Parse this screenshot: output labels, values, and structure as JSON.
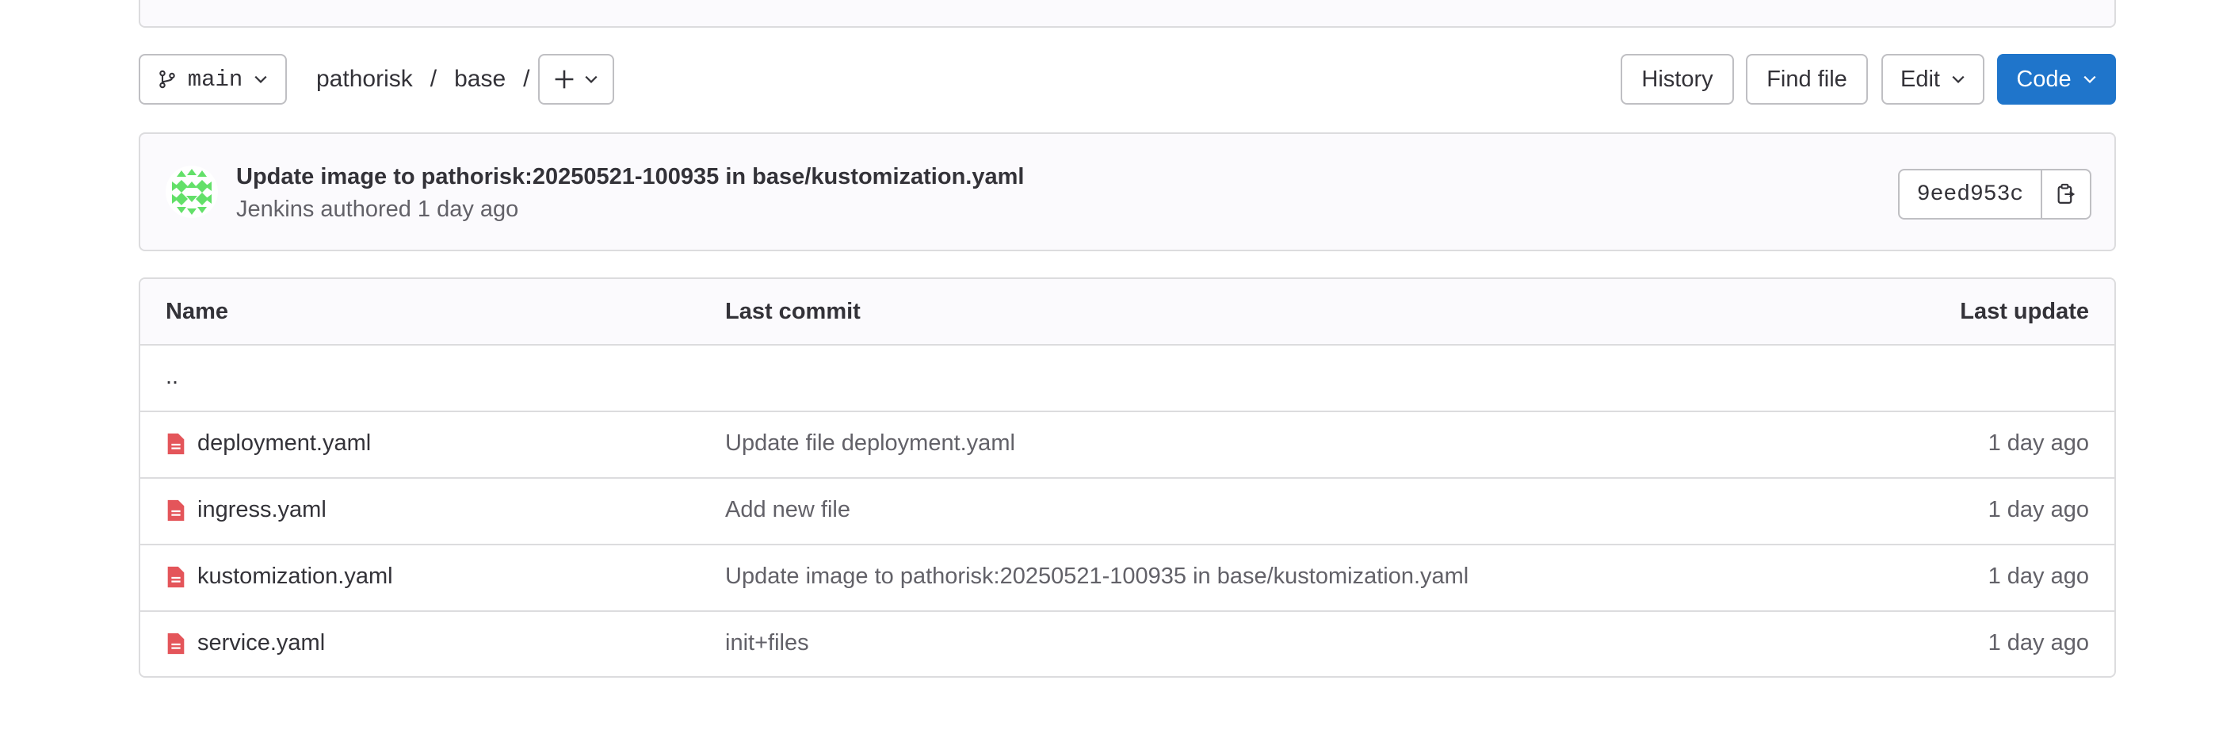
{
  "toolbar": {
    "branch": "main",
    "breadcrumb": [
      "pathorisk",
      "base"
    ],
    "breadcrumb_sep": "/",
    "history_label": "History",
    "find_file_label": "Find file",
    "edit_label": "Edit",
    "code_label": "Code"
  },
  "commit": {
    "title": "Update image to pathorisk:20250521-100935 in base/kustomization.yaml",
    "meta": "Jenkins authored 1 day ago",
    "sha": "9eed953c"
  },
  "table": {
    "headers": {
      "name": "Name",
      "last_commit": "Last commit",
      "last_update": "Last update"
    },
    "parent": "..",
    "rows": [
      {
        "name": "deployment.yaml",
        "commit": "Update file deployment.yaml",
        "updated": "1 day ago"
      },
      {
        "name": "ingress.yaml",
        "commit": "Add new file",
        "updated": "1 day ago"
      },
      {
        "name": "kustomization.yaml",
        "commit": "Update image to pathorisk:20250521-100935 in base/kustomization.yaml",
        "updated": "1 day ago"
      },
      {
        "name": "service.yaml",
        "commit": "init+files",
        "updated": "1 day ago"
      }
    ]
  },
  "colors": {
    "primary": "#1f75cb",
    "file_icon": "#dd2b0e",
    "avatar": "#63e069"
  },
  "icons": {
    "branch": "branch-icon",
    "chevron": "chevron-down-icon",
    "plus": "plus-icon",
    "copy": "copy-icon",
    "file": "file-icon"
  }
}
